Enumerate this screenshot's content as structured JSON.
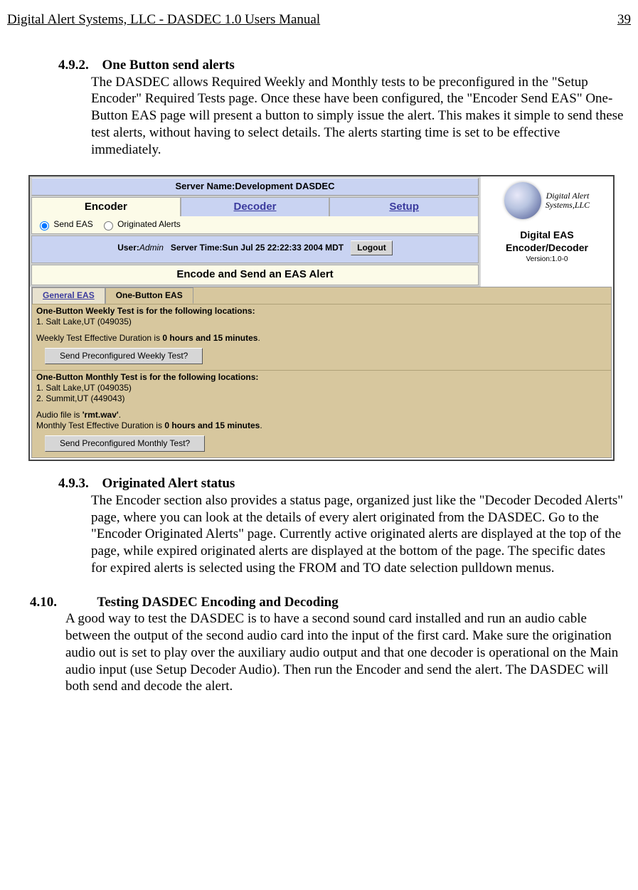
{
  "header": {
    "left": "Digital Alert Systems, LLC - DASDEC 1.0 Users Manual",
    "page": "39"
  },
  "sec492": {
    "num": "4.9.2.",
    "title": "One Button send alerts",
    "body": "The DASDEC allows Required Weekly and Monthly tests to be preconfigured in the \"Setup Encoder\" Required Tests page. Once these have been configured, the \"Encoder Send EAS\" One-Button EAS page will present a button to simply issue the alert. This makes it simple to send these test alerts, without having to select details. The alerts starting time is set to be effective immediately."
  },
  "fig": {
    "server_bar": "Server Name:Development DASDEC",
    "tabs": {
      "encoder": "Encoder",
      "decoder": "Decoder",
      "setup": "Setup"
    },
    "radios": {
      "send": "Send EAS",
      "orig": "Originated Alerts"
    },
    "userline": {
      "user_lbl": "User:",
      "user_val": "Admin",
      "time_lbl": "Server Time:",
      "time_val": "Sun Jul 25 22:22:33 2004 MDT",
      "logout": "Logout"
    },
    "panel_title": "Encode and Send an EAS Alert",
    "brand": {
      "line1": "Digital Alert",
      "line2": "Systems,LLC",
      "title": "Digital EAS Encoder/Decoder",
      "version": "Version:1.0-0"
    },
    "subtabs": {
      "gen": "General EAS",
      "one": "One-Button EAS"
    },
    "weekly": {
      "hdr": "One-Button Weekly Test is for the following locations:",
      "loc1": "1. Salt Lake,UT (049035)",
      "dur_pre": "Weekly Test Effective Duration is ",
      "dur_bold": "0 hours and 15 minutes",
      "btn": "Send Preconfigured Weekly Test?"
    },
    "monthly": {
      "hdr": "One-Button Monthly Test is for the following locations:",
      "loc1": "1. Salt Lake,UT (049035)",
      "loc2": "2. Summit,UT (449043)",
      "audio_pre": "Audio file is ",
      "audio_bold": "'rmt.wav'",
      "dur_pre": "Monthly Test Effective Duration is ",
      "dur_bold": "0 hours and 15 minutes",
      "btn": "Send Preconfigured Monthly Test?"
    }
  },
  "sec493": {
    "num": "4.9.3.",
    "title": "Originated Alert status",
    "body": "The Encoder section also provides a status page, organized just like the \"Decoder Decoded Alerts\" page, where you can look at the details of every alert originated from the DASDEC. Go to the \"Encoder Originated Alerts\" page. Currently active originated alerts are displayed at the top of the page, while expired originated alerts are displayed at the bottom of the page. The specific dates for expired alerts is selected using the FROM and TO date selection pulldown menus."
  },
  "sec410": {
    "num": "4.10.",
    "title": "Testing DASDEC Encoding and Decoding",
    "body": "A good way to test the DASDEC is to have a second sound card installed and run an audio cable between the output of the second audio card into the input of the first card. Make sure the origination audio out is set to play over the auxiliary audio output and that one decoder is operational on the Main audio input (use Setup Decoder Audio). Then run the Encoder and send the alert. The DASDEC will both send and decode the alert."
  }
}
